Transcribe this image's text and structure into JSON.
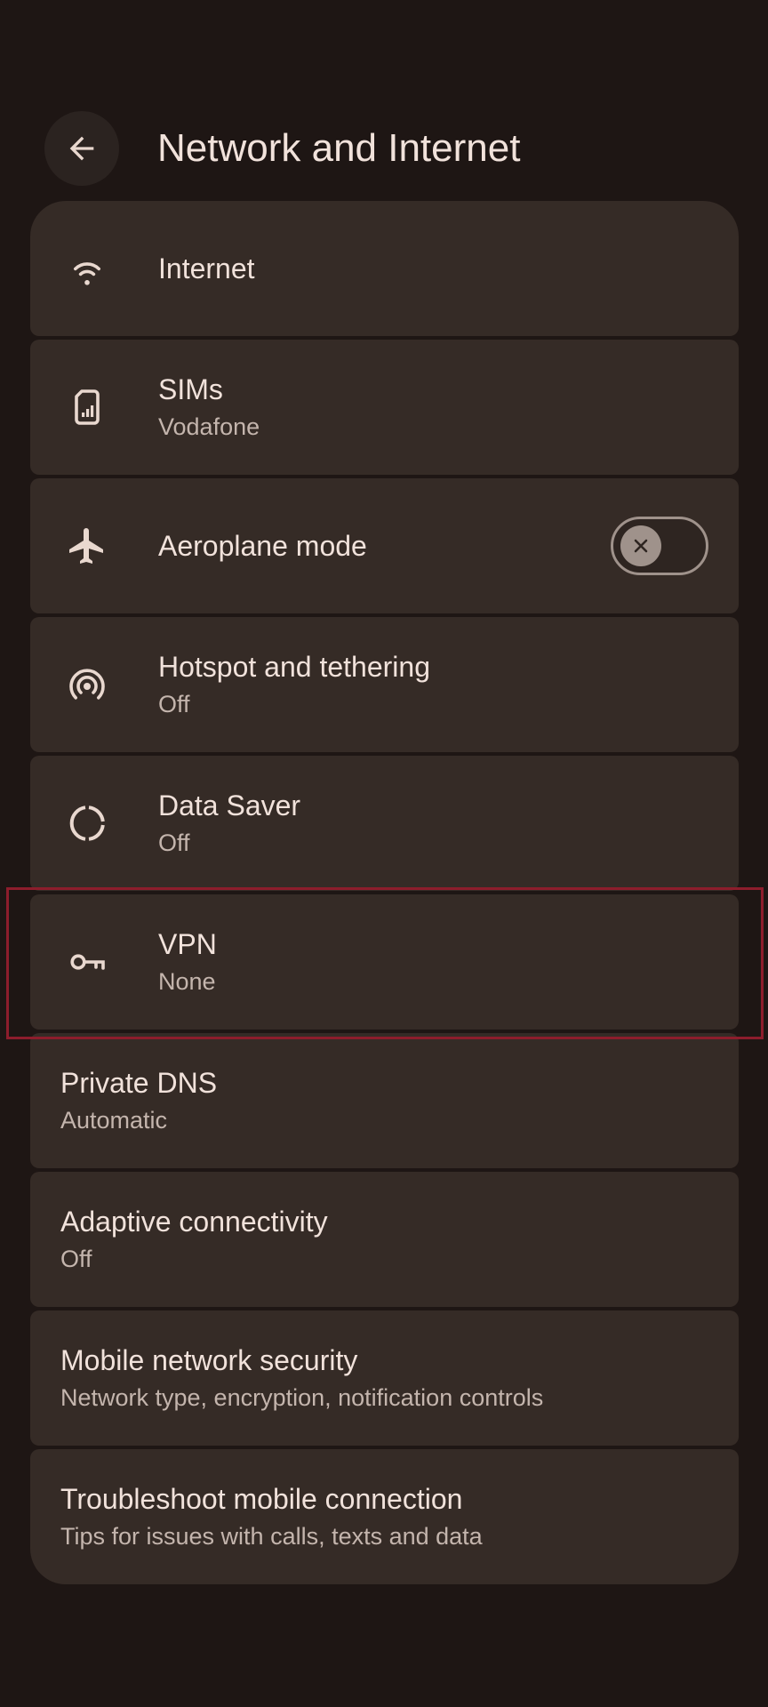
{
  "header": {
    "title": "Network and Internet",
    "back_icon": "arrow-left-icon"
  },
  "items": [
    {
      "id": "internet",
      "title": "Internet",
      "subtitle": "",
      "icon": "wifi-icon"
    },
    {
      "id": "sims",
      "title": "SIMs",
      "subtitle": "Vodafone",
      "icon": "sim-card-icon"
    },
    {
      "id": "aeroplane",
      "title": "Aeroplane mode",
      "subtitle": "",
      "icon": "airplane-icon",
      "toggle": false
    },
    {
      "id": "hotspot",
      "title": "Hotspot and tethering",
      "subtitle": "Off",
      "icon": "hotspot-icon"
    },
    {
      "id": "datasaver",
      "title": "Data Saver",
      "subtitle": "Off",
      "icon": "data-saver-icon"
    },
    {
      "id": "vpn",
      "title": "VPN",
      "subtitle": "None",
      "icon": "vpn-key-icon"
    },
    {
      "id": "privatedns",
      "title": "Private DNS",
      "subtitle": "Automatic"
    },
    {
      "id": "adaptive",
      "title": "Adaptive connectivity",
      "subtitle": "Off"
    },
    {
      "id": "mobilesecurity",
      "title": "Mobile network security",
      "subtitle": "Network type, encryption, notification controls"
    },
    {
      "id": "troubleshoot",
      "title": "Troubleshoot mobile connection",
      "subtitle": "Tips for issues with calls, texts and data"
    }
  ],
  "colors": {
    "background": "#1e1614",
    "card": "#352b26",
    "text_primary": "#f1e2db",
    "text_secondary": "#c4b5ad",
    "highlight_border": "#8d1d2c"
  }
}
